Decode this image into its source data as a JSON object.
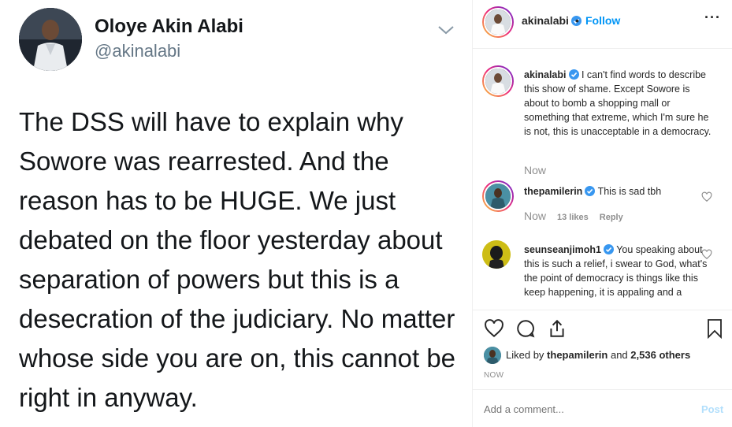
{
  "tweet": {
    "name": "Oloye Akin Alabi",
    "handle": "@akinalabi",
    "body": "The DSS will have to explain why Sowore was rearrested. And the reason has to be HUGE. We just debated on the floor yesterday about separation of powers but this is a desecration of the judiciary. No matter whose side you are on, this cannot be right in anyway."
  },
  "header": {
    "username": "akinalabi",
    "separator": "•",
    "follow_label": "Follow",
    "more_label": "···"
  },
  "comments": [
    {
      "username": "akinalabi",
      "text": "I can't find words to describe this show of shame. Except Sowore is about to bomb a shopping mall or something that extreme, which I'm sure he is not, this is unacceptable in a democracy.",
      "time": "Now"
    },
    {
      "username": "thepamilerin",
      "text": "This is sad tbh",
      "time": "Now",
      "likes": "13 likes",
      "reply": "Reply"
    },
    {
      "username": "seunseanjimoh1",
      "text": "You speaking about this is such a relief, i swear to God, what's the point of democracy is things like this keep happening, it is appaling and a"
    }
  ],
  "likes_line": {
    "prefix": "Liked by",
    "user": "thepamilerin",
    "middle": "and",
    "count": "2,536 others"
  },
  "timestamp": "NOW",
  "add_comment": {
    "placeholder": "Add a comment...",
    "post_label": "Post"
  },
  "colors": {
    "link_blue": "#0095f6",
    "verified_blue": "#3897f0",
    "muted": "#8e8e8e"
  }
}
